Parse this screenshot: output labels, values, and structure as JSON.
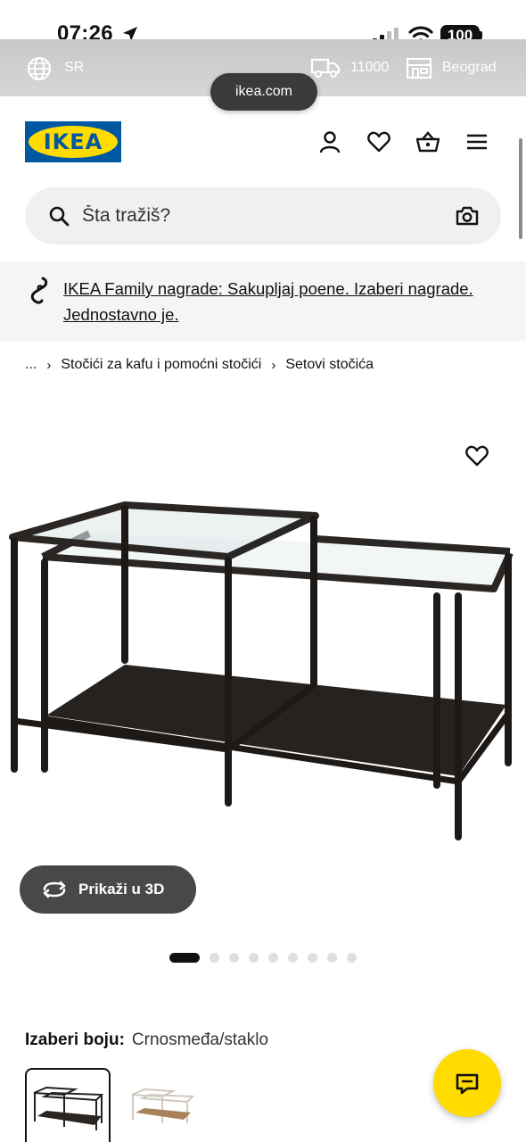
{
  "status_bar": {
    "time": "07:26",
    "battery": "100"
  },
  "top_bar": {
    "language": "SR",
    "postal_code": "11000",
    "store_city": "Beograd",
    "url": "ikea.com"
  },
  "header": {
    "logo_text": "IKEA",
    "icons": [
      "user-icon",
      "heart-icon",
      "basket-icon",
      "menu-icon"
    ]
  },
  "search": {
    "placeholder": "Šta tražiš?"
  },
  "family_banner": {
    "text": "IKEA Family nagrade: Sakupljaj poene. Izaberi nagrade. Jednostavno je."
  },
  "breadcrumb": {
    "ellipsis": "...",
    "items": [
      "Stočići za kafu i pomoćni stočići",
      "Setovi stočića"
    ]
  },
  "product": {
    "view_3d_label": "Prikaži u 3D",
    "image_count": 9,
    "active_image": 1
  },
  "color_selector": {
    "label": "Izaberi boju:",
    "value": "Crnosmeđa/staklo"
  },
  "colors": {
    "brand_blue": "#0058a3",
    "brand_yellow": "#ffdb00"
  }
}
